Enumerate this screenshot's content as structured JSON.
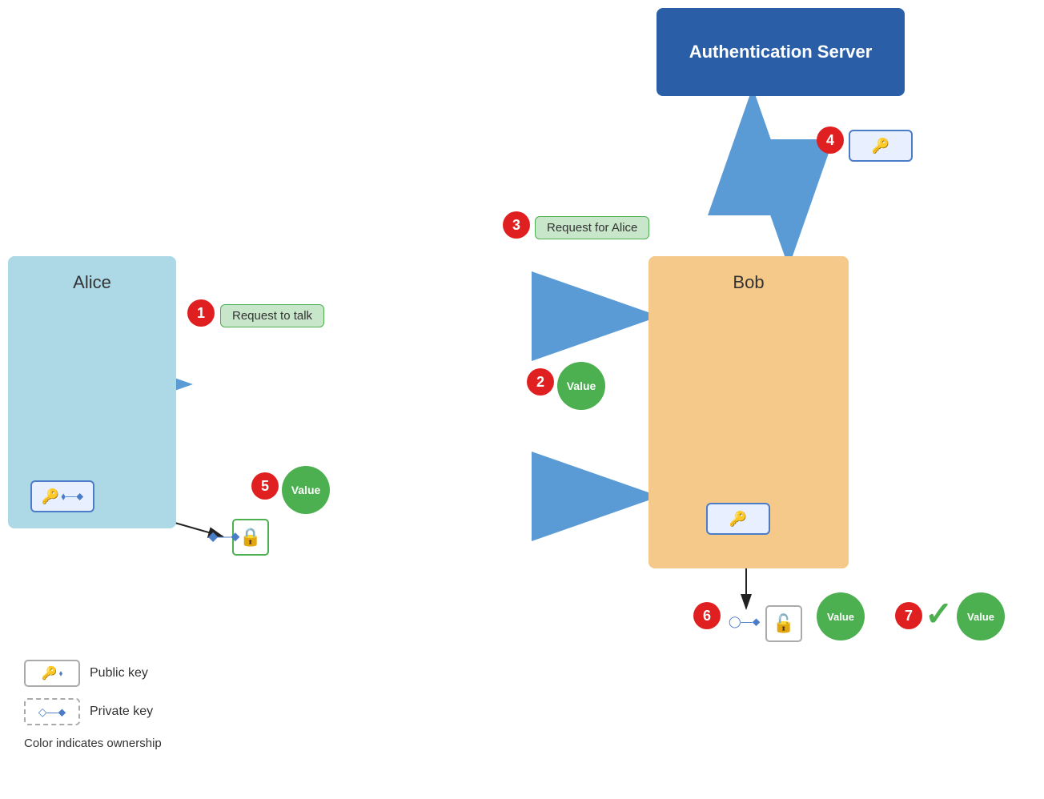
{
  "authServer": {
    "label": "Authentication Server"
  },
  "alice": {
    "label": "Alice"
  },
  "bob": {
    "label": "Bob"
  },
  "steps": {
    "s1": {
      "badge": "1",
      "label": "Request to talk"
    },
    "s2": {
      "badge": "2",
      "label": "Value"
    },
    "s3": {
      "badge": "3",
      "label": "Request for Alice"
    },
    "s4": {
      "badge": "4"
    },
    "s5": {
      "badge": "5",
      "label": "Value"
    },
    "s6": {
      "badge": "6"
    },
    "s7": {
      "badge": "7",
      "label": "Value"
    }
  },
  "legend": {
    "publicKeyLabel": "Public key",
    "privateKeyLabel": "Private key",
    "colorNote": "Color indicates ownership"
  },
  "icons": {
    "key": "🔑",
    "lock": "🔒",
    "lockOpen": "🔓"
  }
}
